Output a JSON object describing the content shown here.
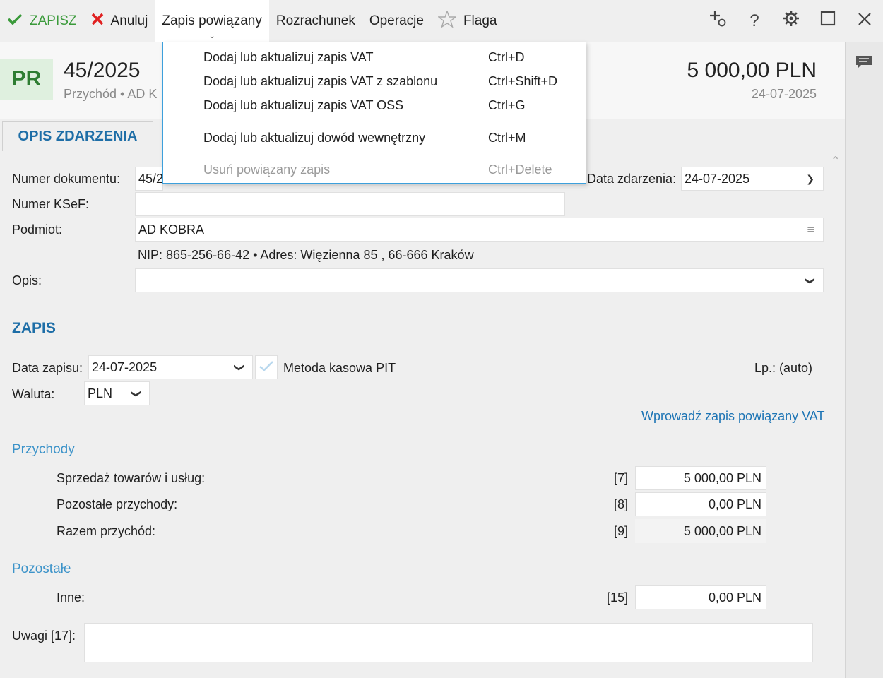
{
  "toolbar": {
    "save": "ZAPISZ",
    "cancel": "Anuluj",
    "linked": "Zapis powiązany",
    "settlement": "Rozrachunek",
    "operations": "Operacje",
    "flag": "Flaga"
  },
  "menu": {
    "items": [
      {
        "label": "Dodaj lub aktualizuj zapis VAT",
        "shortcut": "Ctrl+D"
      },
      {
        "label": "Dodaj lub aktualizuj zapis VAT z szablonu",
        "shortcut": "Ctrl+Shift+D"
      },
      {
        "label": "Dodaj lub aktualizuj zapis VAT OSS",
        "shortcut": "Ctrl+G"
      },
      {
        "label": "Dodaj lub aktualizuj dowód wewnętrzny",
        "shortcut": "Ctrl+M"
      },
      {
        "label": "Usuń powiązany zapis",
        "shortcut": "Ctrl+Delete"
      }
    ]
  },
  "header": {
    "badge": "PR",
    "doc_number": "45/2025",
    "doc_sub": "Przychód  •  AD K",
    "amount": "5 000,00 PLN",
    "date": "24-07-2025"
  },
  "tab": {
    "label": "OPIS ZDARZENIA"
  },
  "form": {
    "doc_number_label": "Numer dokumentu:",
    "doc_number_value": "45/2",
    "event_date_label": "Data zdarzenia:",
    "event_date_value": "24-07-2025",
    "ksef_label": "Numer KSeF:",
    "ksef_value": "",
    "entity_label": "Podmiot:",
    "entity_value": "AD KOBRA",
    "entity_details": "NIP:  865-256-66-42  •  Adres:  Więzienna  85 , 66-666 Kraków",
    "desc_label": "Opis:",
    "desc_value": ""
  },
  "entry": {
    "title": "ZAPIS",
    "date_label": "Data zapisu:",
    "date_value": "24-07-2025",
    "cash_method": "Metoda kasowa PIT",
    "lp": "Lp.:  (auto)",
    "currency_label": "Waluta:",
    "currency_value": "PLN",
    "vat_link": "Wprowadź zapis powiązany VAT"
  },
  "income": {
    "title": "Przychody",
    "rows": [
      {
        "label": "Sprzedaż towarów i usług:",
        "code": "[7]",
        "value": "5 000,00 PLN"
      },
      {
        "label": "Pozostałe przychody:",
        "code": "[8]",
        "value": "0,00 PLN"
      },
      {
        "label": "Razem przychód:",
        "code": "[9]",
        "value": "5 000,00 PLN"
      }
    ]
  },
  "other": {
    "title": "Pozostałe",
    "row": {
      "label": "Inne:",
      "code": "[15]",
      "value": "0,00 PLN"
    }
  },
  "notes": {
    "label": "Uwagi [17]:",
    "value": ""
  }
}
